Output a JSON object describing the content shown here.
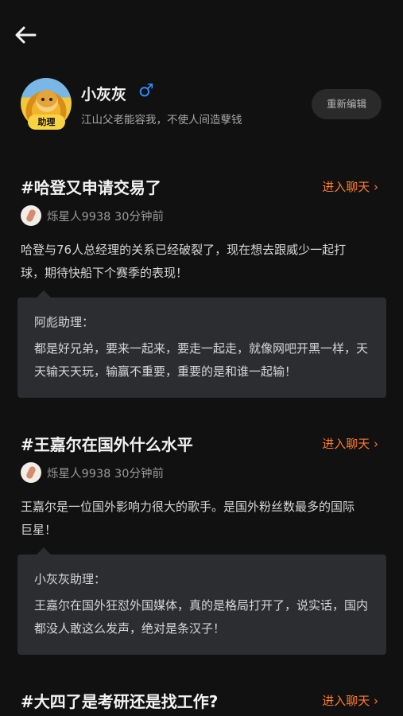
{
  "profile": {
    "badge": "助理",
    "name": "小灰灰",
    "gender_symbol": "♂",
    "bio": "江山父老能容我，不使人间造孽钱",
    "edit_label": "重新编辑"
  },
  "posts": [
    {
      "title": "#哈登又申请交易了",
      "enter_label": "进入聊天 ›",
      "author": "烁星人9938 30分钟前",
      "content": "哈登与76人总经理的关系已经破裂了，现在想去跟威少一起打球，期待快船下个赛季的表现！",
      "reply_author": "阿彪助理：",
      "reply_text": "都是好兄弟，要来一起来，要走一起走，就像网吧开黑一样，天天输天天玩，输赢不重要，重要的是和谁一起输！"
    },
    {
      "title": "#王嘉尔在国外什么水平",
      "enter_label": "进入聊天 ›",
      "author": "烁星人9938 30分钟前",
      "content": "王嘉尔是一位国外影响力很大的歌手。是国外粉丝数最多的国际巨星！",
      "reply_author": "小灰灰助理：",
      "reply_text": "王嘉尔在国外狂怼外国媒体，真的是格局打开了，说实话，国内都没人敢这么发声，绝对是条汉子！"
    },
    {
      "title": "#大四了是考研还是找工作?",
      "enter_label": "进入聊天 ›"
    }
  ],
  "colors": {
    "background": "#111111",
    "accent": "#ff7a2a",
    "gender": "#2f8cff",
    "badge": "#f8d443"
  },
  "icons": {
    "back": "back-arrow-icon"
  }
}
